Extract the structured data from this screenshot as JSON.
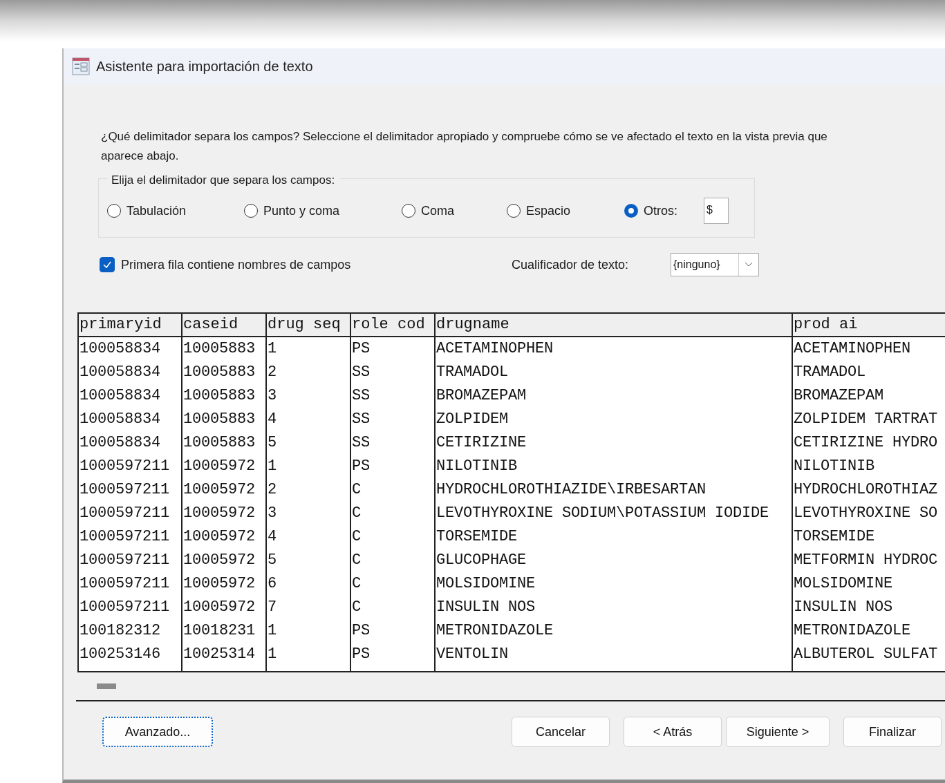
{
  "window": {
    "title": "Asistente para importación de texto"
  },
  "instructions": "¿Qué delimitador separa los campos? Seleccione el delimitador apropiado y compruebe cómo se ve afectado el texto en la vista previa que aparece abajo.",
  "delimiter_group": {
    "label": "Elija el delimitador que separa los campos:",
    "options": [
      {
        "label": "Tabulación",
        "selected": false
      },
      {
        "label": "Punto y coma",
        "selected": false
      },
      {
        "label": "Coma",
        "selected": false
      },
      {
        "label": "Espacio",
        "selected": false
      },
      {
        "label": "Otros:",
        "selected": true
      }
    ],
    "other_value": "$"
  },
  "first_row_names": {
    "label": "Primera fila contiene nombres de campos",
    "checked": true
  },
  "text_qualifier": {
    "label": "Cualificador de texto:",
    "value": "{ninguno}"
  },
  "table": {
    "columns": [
      "primaryid",
      "caseid",
      "drug seq",
      "role cod",
      "drugname",
      "prod ai"
    ],
    "rows": [
      [
        "100058834",
        "10005883",
        "1",
        "PS",
        "ACETAMINOPHEN",
        "ACETAMINOPHEN"
      ],
      [
        "100058834",
        "10005883",
        "2",
        "SS",
        "TRAMADOL",
        "TRAMADOL"
      ],
      [
        "100058834",
        "10005883",
        "3",
        "SS",
        "BROMAZEPAM",
        "BROMAZEPAM"
      ],
      [
        "100058834",
        "10005883",
        "4",
        "SS",
        "ZOLPIDEM",
        "ZOLPIDEM TARTRAT"
      ],
      [
        "100058834",
        "10005883",
        "5",
        "SS",
        "CETIRIZINE",
        "CETIRIZINE HYDRO"
      ],
      [
        "1000597211",
        "10005972",
        "1",
        "PS",
        "NILOTINIB",
        "NILOTINIB"
      ],
      [
        "1000597211",
        "10005972",
        "2",
        "C",
        "HYDROCHLOROTHIAZIDE\\IRBESARTAN",
        "HYDROCHLOROTHIAZ"
      ],
      [
        "1000597211",
        "10005972",
        "3",
        "C",
        "LEVOTHYROXINE SODIUM\\POTASSIUM IODIDE",
        "LEVOTHYROXINE SO"
      ],
      [
        "1000597211",
        "10005972",
        "4",
        "C",
        "TORSEMIDE",
        "TORSEMIDE"
      ],
      [
        "1000597211",
        "10005972",
        "5",
        "C",
        "GLUCOPHAGE",
        "METFORMIN HYDROC"
      ],
      [
        "1000597211",
        "10005972",
        "6",
        "C",
        "MOLSIDOMINE",
        "MOLSIDOMINE"
      ],
      [
        "1000597211",
        "10005972",
        "7",
        "C",
        "INSULIN NOS",
        "INSULIN NOS"
      ],
      [
        "100182312",
        "10018231",
        "1",
        "PS",
        "METRONIDAZOLE",
        "METRONIDAZOLE"
      ],
      [
        "100253146",
        "10025314",
        "1",
        "PS",
        "VENTOLIN",
        "ALBUTEROL SULFAT"
      ]
    ]
  },
  "buttons": {
    "advanced": "Avanzado...",
    "cancel": "Cancelar",
    "back": "< Atrás",
    "next": "Siguiente >",
    "finish": "Finalizar"
  }
}
